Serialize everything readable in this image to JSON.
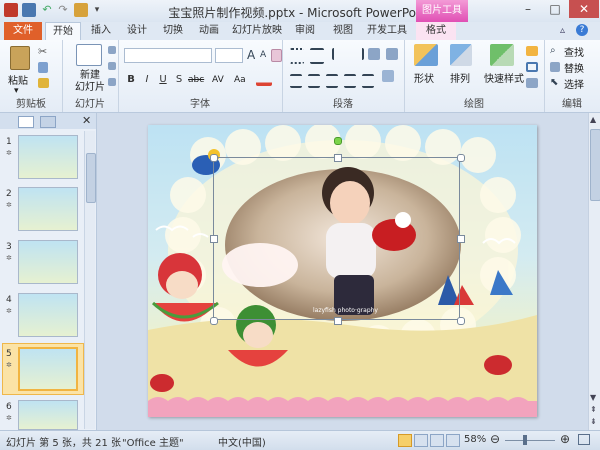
{
  "window": {
    "title": "宝宝照片制作视频.pptx - Microsoft PowerPoint",
    "context_tool": "图片工具",
    "minimize": "–",
    "maximize": "□",
    "close": "✕"
  },
  "tabs": [
    {
      "label": "文件"
    },
    {
      "label": "开始"
    },
    {
      "label": "插入"
    },
    {
      "label": "设计"
    },
    {
      "label": "切换"
    },
    {
      "label": "动画"
    },
    {
      "label": "幻灯片放映"
    },
    {
      "label": "审阅"
    },
    {
      "label": "视图"
    },
    {
      "label": "开发工具"
    },
    {
      "label": "格式"
    }
  ],
  "ribbon": {
    "clipboard": {
      "label": "剪贴板",
      "paste": "粘贴"
    },
    "slides": {
      "label": "幻灯片",
      "new_slide": "新建\n幻灯片"
    },
    "font": {
      "label": "字体",
      "bold": "B",
      "italic": "I",
      "underline": "U",
      "strike": "S",
      "abc": "abc",
      "av": "AV",
      "aa": "Aa",
      "grow": "A",
      "shrink": "A"
    },
    "paragraph": {
      "label": "段落"
    },
    "drawing": {
      "label": "绘图",
      "shape": "形状",
      "arrange": "排列",
      "quick_style": "快速样式"
    },
    "editing": {
      "label": "编辑",
      "find": "查找",
      "replace": "替换",
      "select": "选择"
    }
  },
  "slides_pane": {
    "thumbs": [
      {
        "num": "1"
      },
      {
        "num": "2"
      },
      {
        "num": "3"
      },
      {
        "num": "4"
      },
      {
        "num": "5"
      },
      {
        "num": "6"
      }
    ]
  },
  "slide": {
    "photo_caption": "lazyfish   photo·graphy"
  },
  "status": {
    "slide_info": "幻灯片 第 5 张，共 21 张",
    "theme": "\"Office 主题\"",
    "language": "中文(中国)",
    "zoom": "58%"
  }
}
